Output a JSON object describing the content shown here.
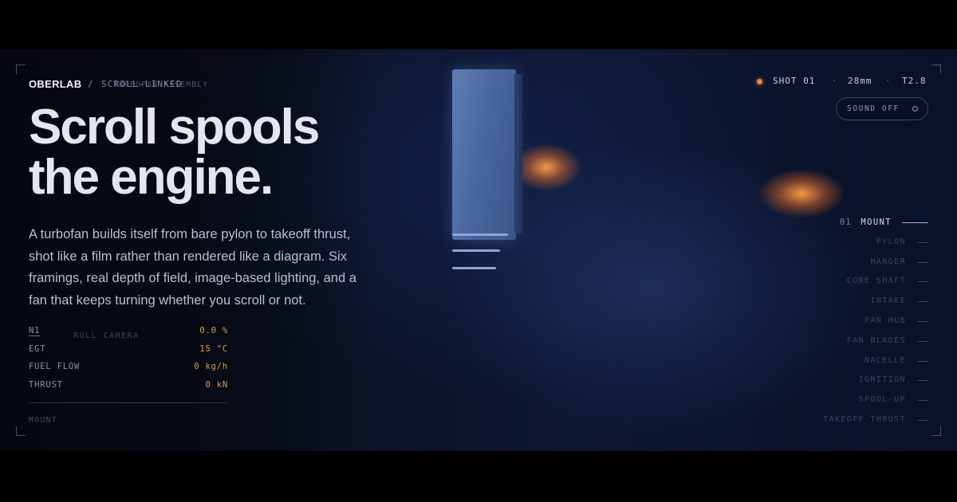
{
  "brand": {
    "name": "OBERLAB",
    "separator": "/",
    "mode": "SCROLL-LINKED",
    "ghost_label": "TURBOFAN ASSEMBLY"
  },
  "hero": {
    "headline_line1": "Scroll spools",
    "headline_line2": "the engine.",
    "lede": "A turbofan builds itself from bare pylon to takeoff thrust, shot like a film rather than rendered like a diagram. Six framings, real depth of field, image-based lighting, and a fan that keeps turning whether you scroll or not."
  },
  "telemetry": {
    "rows": [
      {
        "label": "N1",
        "value": "0.0 %"
      },
      {
        "label": "EGT",
        "value": "15 °C"
      },
      {
        "label": "FUEL FLOW",
        "value": "0 kg/h"
      },
      {
        "label": "THRUST",
        "value": "0 kN"
      }
    ],
    "ghost_label": "ROLL CAMERA",
    "stage": "MOUNT"
  },
  "shot": {
    "label": "SHOT 01",
    "lens": "28mm",
    "aperture": "T2.8",
    "sep": "·",
    "indicator_color": "#e8893a"
  },
  "sound_toggle": {
    "label": "SOUND OFF",
    "icon": "circle-icon"
  },
  "chapters": [
    {
      "num": "01",
      "name": "MOUNT",
      "active": true
    },
    {
      "num": "",
      "name": "PYLON"
    },
    {
      "num": "",
      "name": "HANGER"
    },
    {
      "num": "",
      "name": "CORE SHAFT"
    },
    {
      "num": "",
      "name": "INTAKE"
    },
    {
      "num": "",
      "name": "FAN HUB"
    },
    {
      "num": "",
      "name": "FAN BLADES"
    },
    {
      "num": "",
      "name": "NACELLE"
    },
    {
      "num": "",
      "name": "IGNITION"
    },
    {
      "num": "",
      "name": "SPOOL-UP"
    },
    {
      "num": "",
      "name": "TAKEOFF THRUST"
    }
  ],
  "colors": {
    "accent": "#e8893a",
    "telemetry_value": "#e09a4c",
    "chapter_active_line": "#9fb2e6",
    "background": "#0b1226"
  }
}
